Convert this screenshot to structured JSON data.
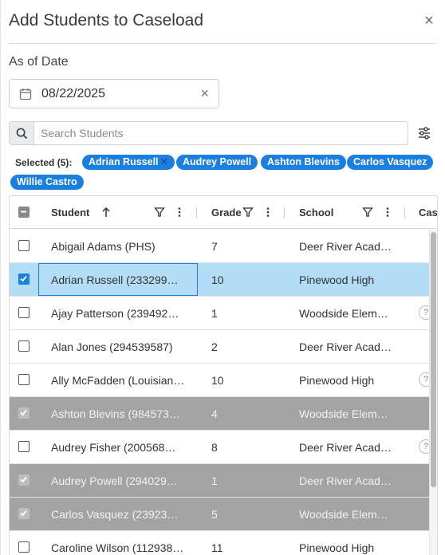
{
  "dialog": {
    "title": "Add Students to Caseload",
    "close_glyph": "×"
  },
  "as_of_date": {
    "label": "As of Date",
    "value": "08/22/2025",
    "clear_glyph": "×",
    "icon": "calendar-icon"
  },
  "search": {
    "placeholder": "Search Students",
    "icon": "search-icon",
    "filter_icon": "sliders-icon"
  },
  "selected": {
    "label": "Selected (5):",
    "chips": [
      "Adrian Russell",
      "Audrey Powell",
      "Ashton Blevins",
      "Carlos Vasquez",
      "Willie Castro"
    ],
    "chip_color": "#1a7fe0"
  },
  "table": {
    "columns": {
      "student": "Student",
      "grade": "Grade",
      "school": "School",
      "caseload": "Cas"
    },
    "rows": [
      {
        "student": "Abigail Adams (PHS)",
        "grade": "7",
        "school": "Deer River Acad…",
        "state": "unchecked"
      },
      {
        "student": "Adrian Russell (233299…",
        "grade": "10",
        "school": "Pinewood High",
        "state": "selected"
      },
      {
        "student": "Ajay Patterson (239492…",
        "grade": "1",
        "school": "Woodside Elem…",
        "state": "unchecked"
      },
      {
        "student": "Alan Jones (294539587)",
        "grade": "2",
        "school": "Deer River Acad…",
        "state": "unchecked"
      },
      {
        "student": "Ally McFadden (Louisian…",
        "grade": "10",
        "school": "Pinewood High",
        "state": "unchecked"
      },
      {
        "student": "Ashton Blevins (984573…",
        "grade": "4",
        "school": "Woodside Elem…",
        "state": "locked"
      },
      {
        "student": "Audrey Fisher (200568…",
        "grade": "8",
        "school": "Deer River Acad…",
        "state": "unchecked"
      },
      {
        "student": "Audrey Powell (294029…",
        "grade": "1",
        "school": "Deer River Acad…",
        "state": "locked"
      },
      {
        "student": "Carlos Vasquez (23923…",
        "grade": "5",
        "school": "Woodside Elem…",
        "state": "locked"
      },
      {
        "student": "Caroline Wilson (112938…",
        "grade": "11",
        "school": "Pinewood High",
        "state": "unchecked"
      }
    ]
  },
  "colors": {
    "accent": "#1a7fe0",
    "selected_row": "#b3dcf7",
    "locked_row": "#a3a3a3"
  }
}
